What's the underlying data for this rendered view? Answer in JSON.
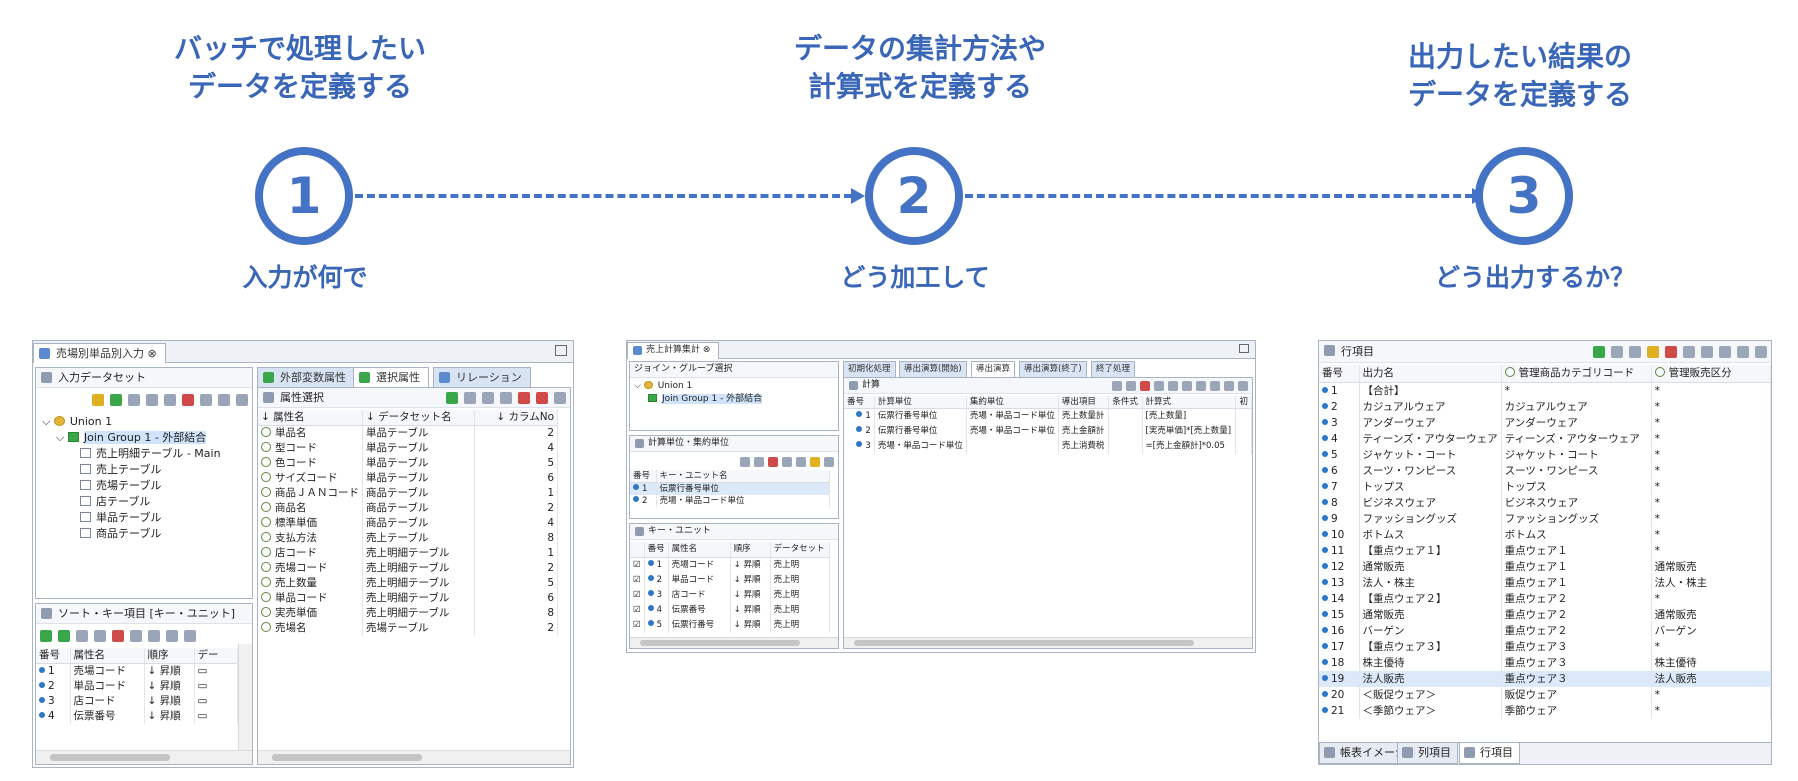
{
  "steps": [
    {
      "number": "1",
      "heading": "バッチで処理したい\nデータを定義する",
      "caption": "入力が何で"
    },
    {
      "number": "2",
      "heading": "データの集計方法や\n計算式を定義する",
      "caption": "どう加工して"
    },
    {
      "number": "3",
      "heading": "出力したい結果の\nデータを定義する",
      "caption": "どう出力するか？"
    }
  ],
  "accent_color": "#4472c4",
  "heading_color": "#3a66b8",
  "window1": {
    "title": "売場別単品別入力",
    "dataset_pane_title": "入力データセット",
    "tree": [
      {
        "label": "Union 1",
        "icon": "union-icon"
      },
      {
        "label": "Join Group 1 - 外部結合",
        "icon": "join-icon"
      },
      {
        "label": "売上明細テーブル - Main",
        "icon": "table-icon"
      },
      {
        "label": "売上テーブル",
        "icon": "table-icon"
      },
      {
        "label": "売場テーブル",
        "icon": "table-icon"
      },
      {
        "label": "店テーブル",
        "icon": "table-icon"
      },
      {
        "label": "単品テーブル",
        "icon": "table-icon"
      },
      {
        "label": "商品テーブル",
        "icon": "table-icon"
      }
    ],
    "sortkey_pane_title": "ソート・キー項目 [キー・ユニット]",
    "sortkey_headers": [
      "番号",
      "属性名",
      "順序",
      "デー"
    ],
    "sortkey_rows": [
      [
        "1",
        "売場コード",
        "昇順"
      ],
      [
        "2",
        "単品コード",
        "昇順"
      ],
      [
        "3",
        "店コード",
        "昇順"
      ],
      [
        "4",
        "伝票番号",
        "昇順"
      ]
    ],
    "right_tabs": [
      "外部変数属性",
      "選択属性",
      "リレーション"
    ],
    "attr_pane_title": "属性選択",
    "attr_headers": [
      "属性名",
      "データセット名",
      "カラムNo"
    ],
    "attr_rows": [
      [
        "単品名",
        "単品テーブル",
        "2"
      ],
      [
        "型コード",
        "単品テーブル",
        "4"
      ],
      [
        "色コード",
        "単品テーブル",
        "5"
      ],
      [
        "サイズコード",
        "単品テーブル",
        "6"
      ],
      [
        "商品ＪＡＮコード",
        "商品テーブル",
        "1"
      ],
      [
        "商品名",
        "商品テーブル",
        "2"
      ],
      [
        "標準単価",
        "商品テーブル",
        "4"
      ],
      [
        "支払方法",
        "売上テーブル",
        "8"
      ],
      [
        "店コード",
        "売上明細テーブル",
        "1"
      ],
      [
        "売場コード",
        "売上明細テーブル",
        "2"
      ],
      [
        "売上数量",
        "売上明細テーブル",
        "5"
      ],
      [
        "単品コード",
        "売上明細テーブル",
        "6"
      ],
      [
        "実売単価",
        "売上明細テーブル",
        "8"
      ],
      [
        "売場名",
        "売場テーブル",
        "2"
      ]
    ]
  },
  "window2": {
    "title": "売上計算集計",
    "join_pane_title": "ジョイン・グループ選択",
    "tree": [
      "Union 1",
      "Join Group 1 - 外部結合"
    ],
    "unit_pane_title": "計算単位・集約単位",
    "unit_headers": [
      "番号",
      "キー・ユニット名"
    ],
    "unit_rows": [
      [
        "1",
        "伝票行番号単位"
      ],
      [
        "2",
        "売場・単品コード単位"
      ]
    ],
    "key_pane_title": "キー・ユニット",
    "key_headers": [
      "番号",
      "属性名",
      "順序",
      "データセット"
    ],
    "key_rows": [
      [
        "1",
        "売場コード",
        "昇順",
        "売上明"
      ],
      [
        "2",
        "単品コード",
        "昇順",
        "売上明"
      ],
      [
        "3",
        "店コード",
        "昇順",
        "売上明"
      ],
      [
        "4",
        "伝票番号",
        "昇順",
        "売上明"
      ],
      [
        "5",
        "伝票行番号",
        "昇順",
        "売上明"
      ]
    ],
    "phase_tabs": [
      "初期化処理",
      "導出演算(開始)",
      "導出演算",
      "導出演算(終了)",
      "終了処理"
    ],
    "calc_pane_title": "計算",
    "calc_headers": [
      "番号",
      "計算単位",
      "集約単位",
      "導出項目",
      "条件式",
      "計算式",
      "初"
    ],
    "calc_rows": [
      [
        "1",
        "伝票行番号単位",
        "売場・単品コード単位",
        "売上数量計",
        "",
        "[売上数量]"
      ],
      [
        "2",
        "伝票行番号単位",
        "売場・単品コード単位",
        "売上金額計",
        "",
        "[実売単価]*[売上数量]"
      ],
      [
        "3",
        "売場・単品コード単位",
        "",
        "売上消費税",
        "",
        "=[売上金額計]*0.05"
      ]
    ]
  },
  "window3": {
    "title": "行項目",
    "headers": [
      "番号",
      "出力名",
      "管理商品カテゴリコード",
      "管理販売区分"
    ],
    "rows": [
      [
        "1",
        "【合計】",
        "*",
        "*"
      ],
      [
        "2",
        "カジュアルウェア",
        "カジュアルウェア",
        "*"
      ],
      [
        "3",
        "アンダーウェア",
        "アンダーウェア",
        "*"
      ],
      [
        "4",
        "ティーンズ・アウターウェア",
        "ティーンズ・アウターウェア",
        "*"
      ],
      [
        "5",
        "ジャケット・コート",
        "ジャケット・コート",
        "*"
      ],
      [
        "6",
        "スーツ・ワンピース",
        "スーツ・ワンピース",
        "*"
      ],
      [
        "7",
        "トップス",
        "トップス",
        "*"
      ],
      [
        "8",
        "ビジネスウェア",
        "ビジネスウェア",
        "*"
      ],
      [
        "9",
        "ファッショングッズ",
        "ファッショングッズ",
        "*"
      ],
      [
        "10",
        "ボトムス",
        "ボトムス",
        "*"
      ],
      [
        "11",
        "【重点ウェア１】",
        "重点ウェア１",
        "*"
      ],
      [
        "12",
        "通常販売",
        "重点ウェア１",
        "通常販売"
      ],
      [
        "13",
        "法人・株主",
        "重点ウェア１",
        "法人・株主"
      ],
      [
        "14",
        "【重点ウェア２】",
        "重点ウェア２",
        "*"
      ],
      [
        "15",
        "通常販売",
        "重点ウェア２",
        "通常販売"
      ],
      [
        "16",
        "バーゲン",
        "重点ウェア２",
        "バーゲン"
      ],
      [
        "17",
        "【重点ウェア３】",
        "重点ウェア３",
        "*"
      ],
      [
        "18",
        "株主優待",
        "重点ウェア３",
        "株主優待"
      ],
      [
        "19",
        "法人販売",
        "重点ウェア３",
        "法人販売"
      ],
      [
        "20",
        "＜販促ウェア＞",
        "販促ウェア",
        "*"
      ],
      [
        "21",
        "＜季節ウェア＞",
        "季節ウェア",
        "*"
      ]
    ],
    "selected_row": "19",
    "bottom_tabs": [
      "帳表イメージ",
      "列項目",
      "行項目"
    ]
  }
}
